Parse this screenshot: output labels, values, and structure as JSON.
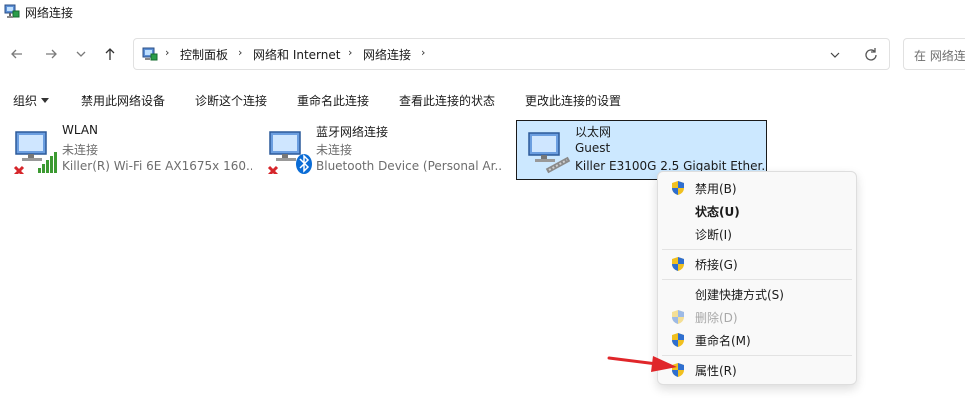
{
  "window": {
    "title": "网络连接"
  },
  "nav": {
    "breadcrumb": [
      "控制面板",
      "网络和 Internet",
      "网络连接"
    ],
    "search_placeholder": "在 网络连"
  },
  "commands": {
    "organize": "组织",
    "disable": "禁用此网络设备",
    "diagnose": "诊断这个连接",
    "rename": "重命名此连接",
    "view_status": "查看此连接的状态",
    "change_settings": "更改此连接的设置"
  },
  "connections": [
    {
      "name": "WLAN",
      "status": "未连接",
      "device": "Killer(R) Wi-Fi 6E AX1675x 160..."
    },
    {
      "name": "蓝牙网络连接",
      "status": "未连接",
      "device": "Bluetooth Device (Personal Ar..."
    },
    {
      "name": "以太网",
      "status": "Guest",
      "device": "Killer E3100G 2.5 Gigabit Ether..."
    }
  ],
  "context_menu": [
    {
      "label": "禁用(B)",
      "icon": "uac-shield-icon"
    },
    {
      "label": "状态(U)",
      "icon": ""
    },
    {
      "label": "诊断(I)",
      "icon": ""
    },
    {
      "label": "桥接(G)",
      "icon": "uac-shield-icon"
    },
    {
      "label": "创建快捷方式(S)",
      "icon": ""
    },
    {
      "label": "删除(D)",
      "icon": "uac-shield-icon",
      "disabled": true
    },
    {
      "label": "重命名(M)",
      "icon": "uac-shield-icon"
    },
    {
      "label": "属性(R)",
      "icon": "uac-shield-icon"
    }
  ],
  "colors": {
    "selection": "#cce8ff",
    "accent_arrow": "#e0262a",
    "error_x": "#d6262b",
    "signal": "#3c9a32",
    "bluetooth": "#0a6cd6"
  }
}
